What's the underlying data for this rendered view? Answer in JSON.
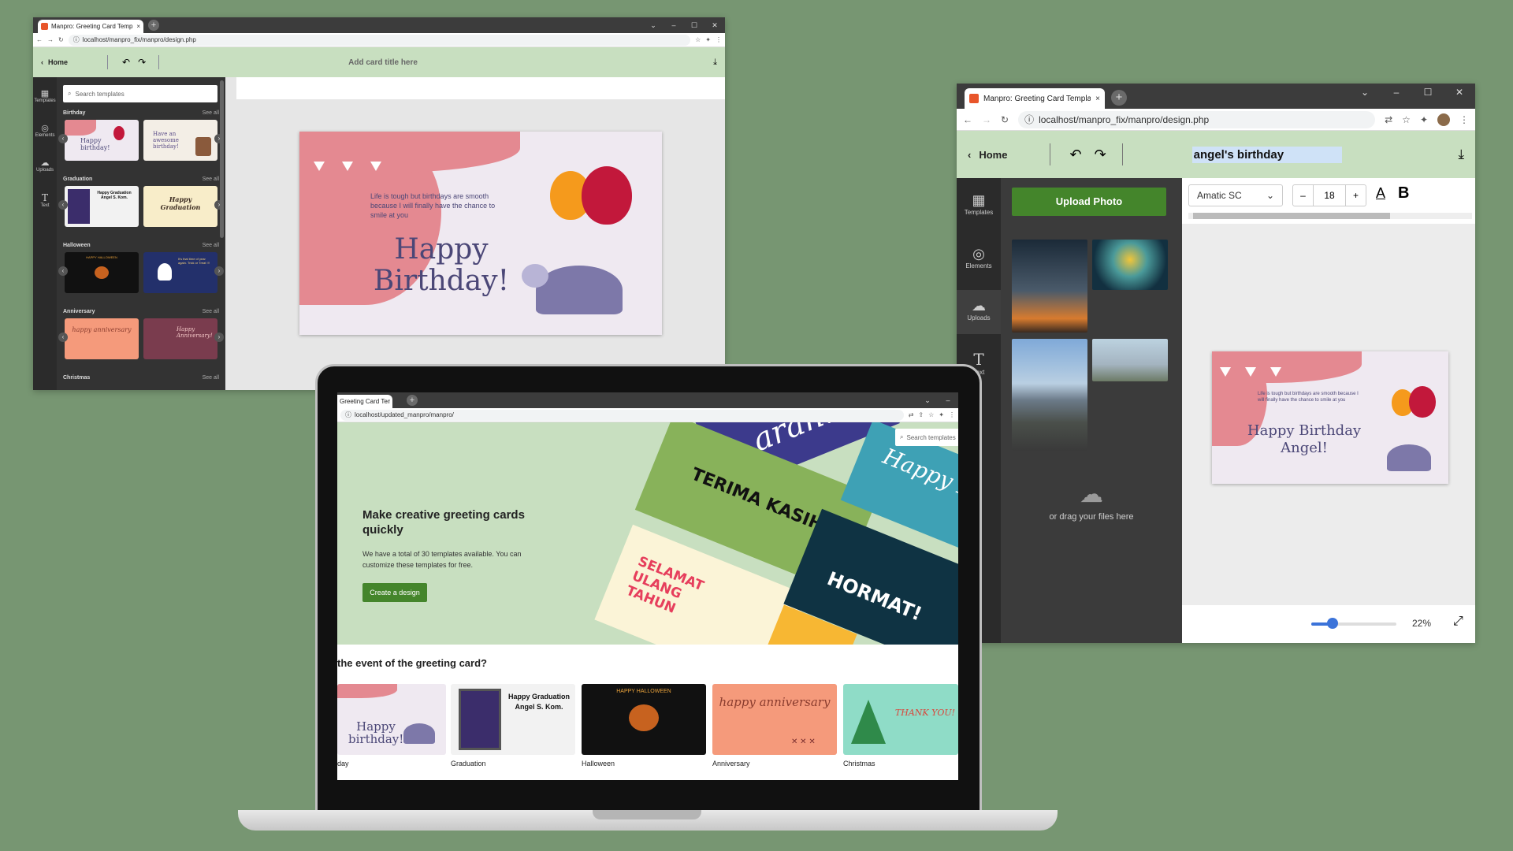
{
  "colors": {
    "bg": "#779672",
    "accent": "#44852b",
    "nav": "#c8dfc0",
    "dark": "#2b2b2b"
  },
  "w1": {
    "tab": "Manpro: Greeting Card Template",
    "url": "localhost/manpro_fix/manpro/design.php",
    "home": "Home",
    "title": "Add card title here",
    "search_placeholder": "Search templates",
    "sidebar": [
      {
        "icon": "templates-icon",
        "label": "Templates"
      },
      {
        "icon": "elements-icon",
        "label": "Elements"
      },
      {
        "icon": "uploads-icon",
        "label": "Uploads"
      },
      {
        "icon": "text-icon",
        "label": "Text"
      }
    ],
    "see_all": "See all",
    "sections": [
      {
        "name": "Birthday",
        "t1": "Happy birthday!",
        "t2": "Have an awesome birthday!"
      },
      {
        "name": "Graduation",
        "t1": "Happy Graduation Angel S. Kom.",
        "t2": "Happy Graduation"
      },
      {
        "name": "Halloween",
        "t1": "HAPPY HALLOWEEN",
        "t2": "It's that time of year again. Trick or Treat !!!"
      },
      {
        "name": "Anniversary",
        "t1": "happy anniversary",
        "t2": "Happy Anniversary!"
      },
      {
        "name": "Christmas"
      }
    ],
    "card": {
      "text": "Life is tough but birthdays are smooth because I will finally have the chance to smile at you",
      "title": "Happy Birthday!"
    }
  },
  "w2": {
    "tab": "Manpro: Greeting Card Template",
    "url": "localhost/manpro_fix/manpro/design.php",
    "home": "Home",
    "title": "angel's birthday",
    "sidebar": [
      {
        "icon": "templates-icon",
        "label": "Templates"
      },
      {
        "icon": "elements-icon",
        "label": "Elements"
      },
      {
        "icon": "uploads-icon",
        "label": "Uploads"
      },
      {
        "icon": "text-icon",
        "label": "Text"
      }
    ],
    "upload_button": "Upload Photo",
    "drag_text": "or drag your files here",
    "font": "Amatic SC",
    "font_size": "18",
    "zoom": "22%",
    "zoom_level": 0.25,
    "card": {
      "text": "Life is tough but birthdays are smooth because I will finally have the chance to smile at you",
      "title": "Happy Birthday Angel!"
    }
  },
  "w3": {
    "tab": "Greeting Card Template",
    "url": "localhost/updated_manpro/manpro/",
    "search_placeholder": "Search templates",
    "hero_title": "Make creative greeting cards quickly",
    "hero_text": "We have a total of 30 templates available. You can customize these templates for free.",
    "cta": "Create a design",
    "tiles": {
      "t1": "TERIMA KASIH",
      "t2": "SELAMAT ULANG TAHUN",
      "t3": "HORMAT!",
      "t4": "Happy B",
      "t5": "aran!"
    },
    "question": "the event of the greeting card?",
    "events": [
      {
        "label": "day",
        "text": "Happy birthday!"
      },
      {
        "label": "Graduation",
        "text": "Happy Graduation Angel S. Kom."
      },
      {
        "label": "Halloween",
        "text": "HAPPY HALLOWEEN"
      },
      {
        "label": "Anniversary",
        "text": "happy anniversary"
      },
      {
        "label": "Christmas",
        "text": "THANK YOU!"
      }
    ]
  }
}
